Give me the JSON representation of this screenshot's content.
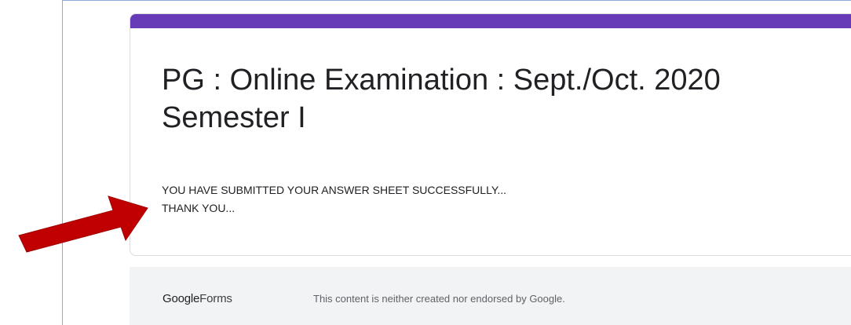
{
  "form": {
    "title": "PG : Online Examination : Sept./Oct. 2020 Semester I",
    "confirmation_line1": "YOU HAVE SUBMITTED YOUR ANSWER SHEET SUCCESSFULLY...",
    "confirmation_line2": "THANK YOU...",
    "accent_color": "#673ab7"
  },
  "footer": {
    "logo_google": "Google",
    "logo_forms": "Forms",
    "disclaimer": "This content is neither created nor endorsed by Google."
  },
  "annotation": {
    "arrow_color": "#c00000",
    "icon": "arrow-annotation-icon"
  }
}
